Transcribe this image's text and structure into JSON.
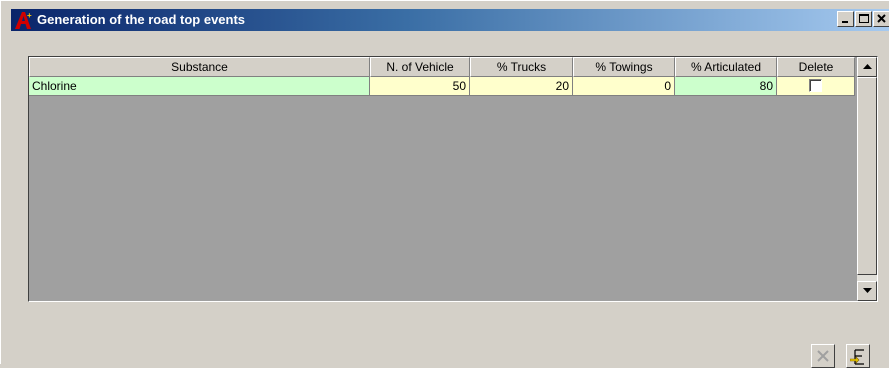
{
  "window": {
    "title": "Generation of the road top events",
    "icon": "app-logo-icon",
    "controls": [
      "minimize-icon",
      "maximize-icon",
      "close-icon"
    ]
  },
  "grid": {
    "columns": [
      "Substance",
      "N. of Vehicle",
      "% Trucks",
      "% Towings",
      "% Articulated",
      "Delete"
    ],
    "rows": [
      {
        "substance": "Chlorine",
        "vehicles": "50",
        "trucks": "20",
        "towings": "0",
        "articulated": "80",
        "delete": false
      }
    ]
  },
  "toolbar": {
    "cancel_icon": "cancel-x-icon",
    "confirm_icon": "generate-icon"
  },
  "colors": {
    "title_start": "#0a246a",
    "title_end": "#a6caf0",
    "cell_green": "#ccffcc",
    "cell_yellow": "#ffffcc",
    "grid_bg": "#a0a0a0"
  }
}
